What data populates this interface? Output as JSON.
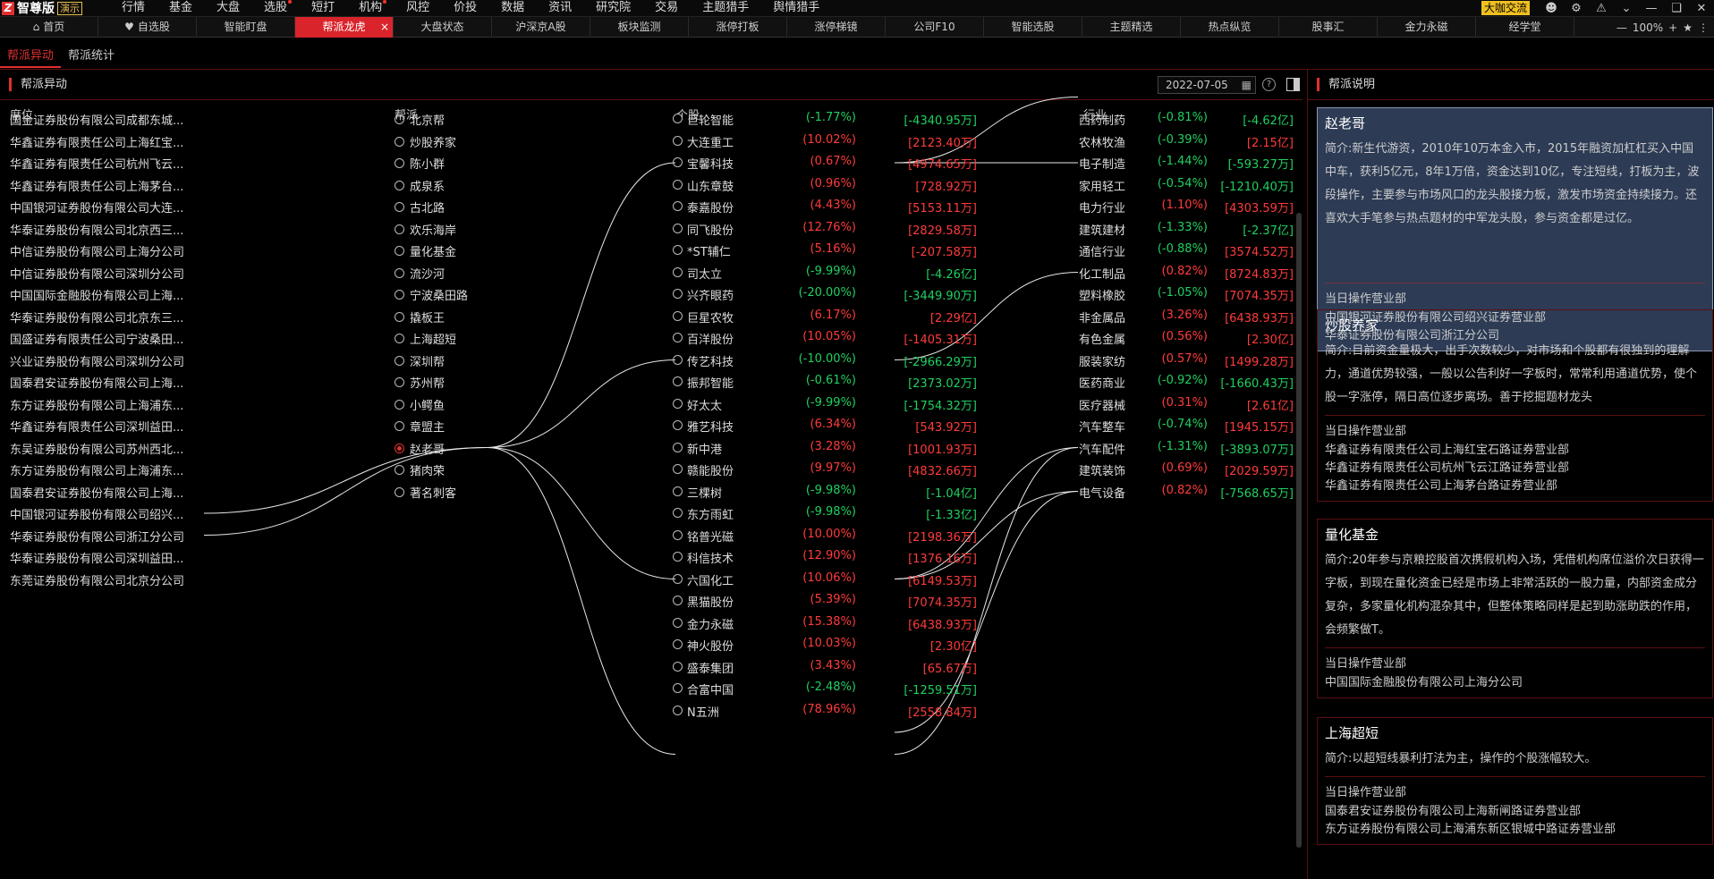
{
  "app": {
    "logo_mark": "Z",
    "name": "智尊版",
    "edition": "演示",
    "promo": "大咖交流",
    "zoom": "100%"
  },
  "menu": [
    {
      "label": "行情",
      "dot": false
    },
    {
      "label": "基金",
      "dot": false
    },
    {
      "label": "大盘",
      "dot": false
    },
    {
      "label": "选股",
      "dot": true
    },
    {
      "label": "短打",
      "dot": false
    },
    {
      "label": "机构",
      "dot": true
    },
    {
      "label": "风控",
      "dot": false
    },
    {
      "label": "价投",
      "dot": false
    },
    {
      "label": "数据",
      "dot": false
    },
    {
      "label": "资讯",
      "dot": false
    },
    {
      "label": "研究院",
      "dot": false
    },
    {
      "label": "交易",
      "dot": false
    },
    {
      "label": "主题猎手",
      "dot": false
    },
    {
      "label": "舆情猎手",
      "dot": false
    }
  ],
  "tabs": [
    {
      "label": "首页",
      "icon": "home-icon"
    },
    {
      "label": "自选股",
      "icon": "heart-icon"
    },
    {
      "label": "智能盯盘"
    },
    {
      "label": "帮派龙虎",
      "active": true
    },
    {
      "label": "大盘状态"
    },
    {
      "label": "沪深京A股"
    },
    {
      "label": "板块监测"
    },
    {
      "label": "涨停打板"
    },
    {
      "label": "涨停梯镜"
    },
    {
      "label": "公司F10"
    },
    {
      "label": "智能选股"
    },
    {
      "label": "主题精选"
    },
    {
      "label": "热点纵览"
    },
    {
      "label": "股事汇"
    },
    {
      "label": "金力永磁"
    },
    {
      "label": "经学堂"
    }
  ],
  "subtabs": [
    {
      "label": "帮派异动",
      "active": true
    },
    {
      "label": "帮派统计"
    }
  ],
  "main": {
    "title": "帮派异动",
    "date": "2022-07-05",
    "headers": {
      "seat": "席位",
      "gang": "帮派",
      "stock": "个股",
      "industry": "行业"
    }
  },
  "seats": [
    "国金证券股份有限公司成都东城...",
    "华鑫证券有限责任公司上海红宝...",
    "华鑫证券有限责任公司杭州飞云...",
    "华鑫证券有限责任公司上海茅台...",
    "中国银河证券股份有限公司大连...",
    "华泰证券股份有限公司北京西三...",
    "中信证券股份有限公司上海分公司",
    "中信证券股份有限公司深圳分公司",
    "中国国际金融股份有限公司上海...",
    "华泰证券股份有限公司北京东三...",
    "国盛证券有限责任公司宁波桑田...",
    "兴业证券股份有限公司深圳分公司",
    "国泰君安证券股份有限公司上海...",
    "东方证券股份有限公司上海浦东...",
    "华鑫证券有限责任公司深圳益田...",
    "东吴证券股份有限公司苏州西北...",
    "东方证券股份有限公司上海浦东...",
    "国泰君安证券股份有限公司上海...",
    "中国银河证券股份有限公司绍兴...",
    "华泰证券股份有限公司浙江分公司",
    "华泰证券股份有限公司深圳益田...",
    "东莞证券股份有限公司北京分公司"
  ],
  "gangs": [
    {
      "label": "北京帮"
    },
    {
      "label": "炒股养家"
    },
    {
      "label": "陈小群"
    },
    {
      "label": "成泉系"
    },
    {
      "label": "古北路"
    },
    {
      "label": "欢乐海岸"
    },
    {
      "label": "量化基金"
    },
    {
      "label": "流沙河"
    },
    {
      "label": "宁波桑田路"
    },
    {
      "label": "撬板王"
    },
    {
      "label": "上海超短"
    },
    {
      "label": "深圳帮"
    },
    {
      "label": "苏州帮"
    },
    {
      "label": "小鳄鱼"
    },
    {
      "label": "章盟主"
    },
    {
      "label": "赵老哥",
      "selected": true
    },
    {
      "label": "猪肉荣"
    },
    {
      "label": "著名刺客"
    }
  ],
  "stocks": [
    {
      "name": "巨轮智能",
      "pct": "(-1.77%)",
      "amt": "[-4340.95万]",
      "dir": "down"
    },
    {
      "name": "大连重工",
      "pct": "(10.02%)",
      "amt": "[2123.40万]",
      "dir": "up"
    },
    {
      "name": "宝馨科技",
      "pct": "(0.67%)",
      "amt": "[4974.65万]",
      "dir": "up"
    },
    {
      "name": "山东章鼓",
      "pct": "(0.96%)",
      "amt": "[728.92万]",
      "dir": "up"
    },
    {
      "name": "泰嘉股份",
      "pct": "(4.43%)",
      "amt": "[5153.11万]",
      "dir": "up"
    },
    {
      "name": "同飞股份",
      "pct": "(12.76%)",
      "amt": "[2829.58万]",
      "dir": "up"
    },
    {
      "name": "*ST辅仁",
      "pct": "(5.16%)",
      "amt": "[-207.58万]",
      "dir": "up"
    },
    {
      "name": "司太立",
      "pct": "(-9.99%)",
      "amt": "[-4.26亿]",
      "dir": "down"
    },
    {
      "name": "兴齐眼药",
      "pct": "(-20.00%)",
      "amt": "[-3449.90万]",
      "dir": "down"
    },
    {
      "name": "巨星农牧",
      "pct": "(6.17%)",
      "amt": "[2.29亿]",
      "dir": "up"
    },
    {
      "name": "百洋股份",
      "pct": "(10.05%)",
      "amt": "[-1405.31万]",
      "dir": "up"
    },
    {
      "name": "传艺科技",
      "pct": "(-10.00%)",
      "amt": "[-2966.29万]",
      "dir": "down"
    },
    {
      "name": "振邦智能",
      "pct": "(-0.61%)",
      "amt": "[2373.02万]",
      "dir": "down"
    },
    {
      "name": "好太太",
      "pct": "(-9.99%)",
      "amt": "[-1754.32万]",
      "dir": "down"
    },
    {
      "name": "雅艺科技",
      "pct": "(6.34%)",
      "amt": "[543.92万]",
      "dir": "up"
    },
    {
      "name": "新中港",
      "pct": "(3.28%)",
      "amt": "[1001.93万]",
      "dir": "up"
    },
    {
      "name": "赣能股份",
      "pct": "(9.97%)",
      "amt": "[4832.66万]",
      "dir": "up"
    },
    {
      "name": "三棵树",
      "pct": "(-9.98%)",
      "amt": "[-1.04亿]",
      "dir": "down"
    },
    {
      "name": "东方雨虹",
      "pct": "(-9.98%)",
      "amt": "[-1.33亿]",
      "dir": "down"
    },
    {
      "name": "铭普光磁",
      "pct": "(10.00%)",
      "amt": "[2198.36万]",
      "dir": "up"
    },
    {
      "name": "科信技术",
      "pct": "(12.90%)",
      "amt": "[1376.16万]",
      "dir": "up"
    },
    {
      "name": "六国化工",
      "pct": "(10.06%)",
      "amt": "[6149.53万]",
      "dir": "up"
    },
    {
      "name": "黑猫股份",
      "pct": "(5.39%)",
      "amt": "[7074.35万]",
      "dir": "up"
    },
    {
      "name": "金力永磁",
      "pct": "(15.38%)",
      "amt": "[6438.93万]",
      "dir": "up"
    },
    {
      "name": "神火股份",
      "pct": "(10.03%)",
      "amt": "[2.30亿]",
      "dir": "up"
    },
    {
      "name": "盛泰集团",
      "pct": "(3.43%)",
      "amt": "[65.67万]",
      "dir": "up"
    },
    {
      "name": "合富中国",
      "pct": "(-2.48%)",
      "amt": "[-1259.51万]",
      "dir": "down"
    },
    {
      "name": "N五洲",
      "pct": "(78.96%)",
      "amt": "[2558.84万]",
      "dir": "up"
    }
  ],
  "industries": [
    {
      "name": "西药制药",
      "pct": "(-0.81%)",
      "amt": "[-4.62亿]",
      "pdir": "down",
      "adir": "down"
    },
    {
      "name": "农林牧渔",
      "pct": "(-0.39%)",
      "amt": "[2.15亿]",
      "pdir": "down",
      "adir": "up"
    },
    {
      "name": "电子制造",
      "pct": "(-1.44%)",
      "amt": "[-593.27万]",
      "pdir": "down",
      "adir": "down"
    },
    {
      "name": "家用轻工",
      "pct": "(-0.54%)",
      "amt": "[-1210.40万]",
      "pdir": "down",
      "adir": "down"
    },
    {
      "name": "电力行业",
      "pct": "(1.10%)",
      "amt": "[4303.59万]",
      "pdir": "up",
      "adir": "up"
    },
    {
      "name": "建筑建材",
      "pct": "(-1.33%)",
      "amt": "[-2.37亿]",
      "pdir": "down",
      "adir": "down"
    },
    {
      "name": "通信行业",
      "pct": "(-0.88%)",
      "amt": "[3574.52万]",
      "pdir": "down",
      "adir": "up"
    },
    {
      "name": "化工制品",
      "pct": "(0.82%)",
      "amt": "[8724.83万]",
      "pdir": "up",
      "adir": "up"
    },
    {
      "name": "塑料橡胶",
      "pct": "(-1.05%)",
      "amt": "[7074.35万]",
      "pdir": "down",
      "adir": "up"
    },
    {
      "name": "非金属品",
      "pct": "(3.26%)",
      "amt": "[6438.93万]",
      "pdir": "up",
      "adir": "up"
    },
    {
      "name": "有色金属",
      "pct": "(0.56%)",
      "amt": "[2.30亿]",
      "pdir": "up",
      "adir": "up"
    },
    {
      "name": "服装家纺",
      "pct": "(0.57%)",
      "amt": "[1499.28万]",
      "pdir": "up",
      "adir": "up"
    },
    {
      "name": "医药商业",
      "pct": "(-0.92%)",
      "amt": "[-1660.43万]",
      "pdir": "down",
      "adir": "down"
    },
    {
      "name": "医疗器械",
      "pct": "(0.31%)",
      "amt": "[2.61亿]",
      "pdir": "up",
      "adir": "up"
    },
    {
      "name": "汽车整车",
      "pct": "(-0.74%)",
      "amt": "[1945.15万]",
      "pdir": "down",
      "adir": "up"
    },
    {
      "name": "汽车配件",
      "pct": "(-1.31%)",
      "amt": "[-3893.07万]",
      "pdir": "down",
      "adir": "down"
    },
    {
      "name": "建筑装饰",
      "pct": "(0.69%)",
      "amt": "[2029.59万]",
      "pdir": "up",
      "adir": "up"
    },
    {
      "name": "电气设备",
      "pct": "(0.82%)",
      "amt": "[-7568.65万]",
      "pdir": "up",
      "adir": "down"
    }
  ],
  "links": {
    "seat_to_gang": [
      [
        18,
        15
      ],
      [
        19,
        15
      ]
    ],
    "gang_to_stock": [
      [
        15,
        2
      ],
      [
        15,
        11
      ],
      [
        15,
        21
      ],
      [
        15,
        29
      ]
    ],
    "stock_to_industry": [
      [
        2,
        -1
      ],
      [
        2,
        2
      ],
      [
        11,
        7
      ],
      [
        21,
        15
      ],
      [
        21,
        17
      ],
      [
        28,
        17
      ],
      [
        29,
        15
      ]
    ]
  },
  "right": {
    "title": "帮派说明",
    "ops_label": "当日操作营业部",
    "cards": [
      {
        "name": "赵老哥",
        "selected": true,
        "intro": "简介:新生代游资，2010年10万本金入市，2015年融资加杠杠买入中国中车，获利5亿元，8年1万倍，资金达到10亿，专注短线，打板为主，波段操作，主要参与市场风口的龙头股接力板，激发市场资金持续接力。还喜欢大手笔参与热点题材的中军龙头股，参与资金都是过亿。",
        "ops": [
          "中国银河证券股份有限公司绍兴证券营业部",
          "华泰证券股份有限公司浙江分公司"
        ]
      },
      {
        "name": "炒股养家",
        "selected": false,
        "intro": "简介:目前资金量极大，出手次数较少，对市场和个股都有很独到的理解力，通道优势较强，一般以公告利好一字板时，常常利用通道优势，使个股一字涨停，隔日高位逐步离场。善于挖掘题材龙头",
        "ops": [
          "华鑫证券有限责任公司上海红宝石路证券营业部",
          "华鑫证券有限责任公司杭州飞云江路证券营业部",
          "华鑫证券有限责任公司上海茅台路证券营业部"
        ]
      },
      {
        "name": "量化基金",
        "selected": false,
        "intro": "简介:20年参与京粮控股首次携假机构入场，凭借机构席位溢价次日获得一字板，到现在量化资金已经是市场上非常活跃的一股力量，内部资金成分复杂，多家量化机构混杂其中，但整体策略同样是起到助涨助跌的作用，会频繁做T。",
        "ops": [
          "中国国际金融股份有限公司上海分公司"
        ]
      },
      {
        "name": "上海超短",
        "selected": false,
        "intro": "简介:以超短线暴利打法为主，操作的个股涨幅较大。",
        "ops": [
          "国泰君安证券股份有限公司上海新闸路证券营业部",
          "东方证券股份有限公司上海浦东新区银城中路证券营业部"
        ]
      }
    ]
  },
  "colors": {
    "up": "#ff3b3b",
    "down": "#20d060",
    "accent": "#d9242b",
    "selected_card": "#2d3b55"
  }
}
